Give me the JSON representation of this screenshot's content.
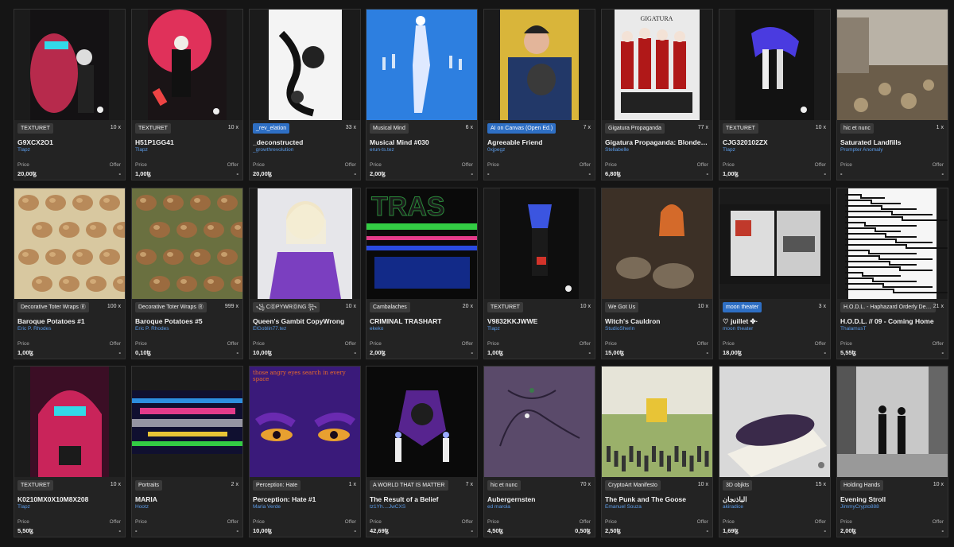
{
  "price_label": "Price",
  "offer_label": "Offer",
  "cards": [
    {
      "collection": "TEXTURET",
      "collection_style": "dark",
      "editions": "10 x",
      "title": "G9XCX2O1",
      "artist": "Tlapz",
      "price": "20,00ꜩ",
      "offer": "-",
      "art": "red-skull-dark",
      "accent": "#e0315a"
    },
    {
      "collection": "TEXTURET",
      "collection_style": "dark",
      "editions": "10 x",
      "title": "H51P1GG41",
      "artist": "Tlapz",
      "price": "1,00ꜩ",
      "offer": "-",
      "art": "red-splash-suit",
      "accent": "#e0315a"
    },
    {
      "collection": "_rev_elation",
      "collection_style": "blue",
      "editions": "33 x",
      "title": "_deconstructed",
      "artist": "_growthrevolution",
      "price": "20,00ꜩ",
      "offer": "-",
      "art": "ink-white",
      "accent": "#222222"
    },
    {
      "collection": "Musical Mind",
      "collection_style": "dark",
      "editions": "6 x",
      "title": "Musical Mind #030",
      "artist": "erun-ts.tez",
      "price": "2,00ꜩ",
      "offer": "-",
      "art": "blue-figures",
      "accent": "#2d7fe0"
    },
    {
      "collection": "AI on Canvas (Open Ed.)",
      "collection_style": "blue",
      "editions": "7 x",
      "title": "Agreeable Friend",
      "artist": "0xjpegz",
      "price": "-",
      "offer": "-",
      "art": "woman-cat",
      "accent": "#e8c436"
    },
    {
      "collection": "Gigatura Propaganda",
      "collection_style": "dark",
      "editions": "77 x",
      "title": "Gigatura Propaganda: Blondes from Hell",
      "artist": "Stellabelle",
      "price": "6,80ꜩ",
      "offer": "-",
      "art": "figures-poster",
      "accent": "#b01818"
    },
    {
      "collection": "TEXTURET",
      "collection_style": "dark",
      "editions": "10 x",
      "title": "CJG320102ZX",
      "artist": "Tlapz",
      "price": "1,00ꜩ",
      "offer": "-",
      "art": "purple-hands",
      "accent": "#4a3be0"
    },
    {
      "collection": "hic et nunc",
      "collection_style": "dark",
      "editions": "1 x",
      "title": "Saturated Landfills",
      "artist": "Prompter Anomaly",
      "price": "-",
      "offer": "-",
      "art": "landfill",
      "accent": "#8a7c6a"
    },
    {
      "collection": "Decorative Toter Wraps Ⓡ",
      "collection_style": "dark",
      "editions": "100 x",
      "title": "Baroque Potatoes #1",
      "artist": "Eric P. Rhodes",
      "price": "1,00ꜩ",
      "offer": "-",
      "art": "potatoes-1",
      "accent": "#b88a5a"
    },
    {
      "collection": "Decorative Toter Wraps Ⓡ",
      "collection_style": "dark",
      "editions": "999 x",
      "title": "Baroque Potatoes #5",
      "artist": "Eric P. Rhodes",
      "price": "0,10ꜩ",
      "offer": "-",
      "art": "potatoes-5",
      "accent": "#9b6b3f"
    },
    {
      "collection": "꧁ CⓄPYWRⓄNG ꧂",
      "collection_style": "dark",
      "editions": "10 x",
      "title": "Queen's Gambit CopyWrong",
      "artist": "ElGoblin77.tez",
      "price": "10,00ꜩ",
      "offer": "-",
      "art": "blonde-purple",
      "accent": "#7b3fc0"
    },
    {
      "collection": "Cambalaches",
      "collection_style": "dark",
      "editions": "20 x",
      "title": "CRIMINAL TRASHART",
      "artist": "ekeko",
      "price": "2,00ꜩ",
      "offer": "-",
      "art": "glitch-trash",
      "accent": "#33cc44"
    },
    {
      "collection": "TEXTURET",
      "collection_style": "dark",
      "editions": "10 x",
      "title": "V9832KKJWWE",
      "artist": "Tlapz",
      "price": "1,00ꜩ",
      "offer": "-",
      "art": "blue-head-suit",
      "accent": "#3b55e0"
    },
    {
      "collection": "We Got Us",
      "collection_style": "dark",
      "editions": "10 x",
      "title": "Witch's Cauldron",
      "artist": "StudioSherin",
      "price": "15,00ꜩ",
      "offer": "-",
      "art": "witch",
      "accent": "#d46a2a"
    },
    {
      "collection": "moon theater",
      "collection_style": "blue",
      "editions": "3 x",
      "title": "♡ juillet ✤·",
      "artist": "moon theater",
      "price": "18,00ꜩ",
      "offer": "-",
      "art": "collage-book",
      "accent": "#c0392b"
    },
    {
      "collection": "H.O.D.L. - Haphazard Orderly Desultory Lines",
      "collection_style": "dark",
      "editions": "21 x",
      "title": "H.O.D.L. // 09 - Coming Home",
      "artist": "ThalamusT",
      "price": "5,55ꜩ",
      "offer": "-",
      "art": "maze-lines",
      "accent": "#111111"
    },
    {
      "collection": "TEXTURET",
      "collection_style": "dark",
      "editions": "10 x",
      "title": "K0210MX0X10M8X208",
      "artist": "Tlapz",
      "price": "5,50ꜩ",
      "offer": "-",
      "art": "pink-hoodie",
      "accent": "#c9245a"
    },
    {
      "collection": "Portraits",
      "collection_style": "dark",
      "editions": "2 x",
      "title": "MARIA",
      "artist": "Hootz",
      "price": "-",
      "offer": "-",
      "art": "glitch-strip",
      "accent": "#2d8fe0"
    },
    {
      "collection": "Perception: Hate",
      "collection_style": "dark",
      "editions": "1 x",
      "title": "Perception: Hate #1",
      "artist": "Maria Verde",
      "price": "10,00ꜩ",
      "offer": "-",
      "art": "angry-eyes",
      "accent": "#3a1a7a",
      "caption": "those angry eyes search in every space"
    },
    {
      "collection": "A WORLD THAT IS MATTER",
      "collection_style": "dark",
      "editions": "7 x",
      "title": "The Result of a Belief",
      "artist": "tz1Yh....JwCXS",
      "price": "42,69ꜩ",
      "offer": "-",
      "art": "skull-candles",
      "accent": "#6a2ab0"
    },
    {
      "collection": "hic et nunc",
      "collection_style": "dark",
      "editions": "70 x",
      "title": "Aubergernsten",
      "artist": "ed marola",
      "price": "4,50ꜩ",
      "offer": "0,50ꜩ",
      "art": "purple-map",
      "accent": "#5a4a6a"
    },
    {
      "collection": "CryptoArt Manifesto",
      "collection_style": "dark",
      "editions": "10 x",
      "title": "The Punk and The Goose",
      "artist": "Emanuel Souza",
      "price": "2,50ꜩ",
      "offer": "-",
      "art": "crowd-field",
      "accent": "#9ab06a"
    },
    {
      "collection": "3D objkts",
      "collection_style": "dark",
      "editions": "15 x",
      "title": "الباذنجان",
      "artist": "akiradice",
      "price": "1,69ꜩ",
      "offer": "-",
      "art": "eggplant",
      "accent": "#3a2a4a"
    },
    {
      "collection": "Holding Hands",
      "collection_style": "dark",
      "editions": "10 x",
      "title": "Evening Stroll",
      "artist": "JimmyCrypto888",
      "price": "2,00ꜩ",
      "offer": "-",
      "art": "couple-street",
      "accent": "#888888"
    }
  ]
}
